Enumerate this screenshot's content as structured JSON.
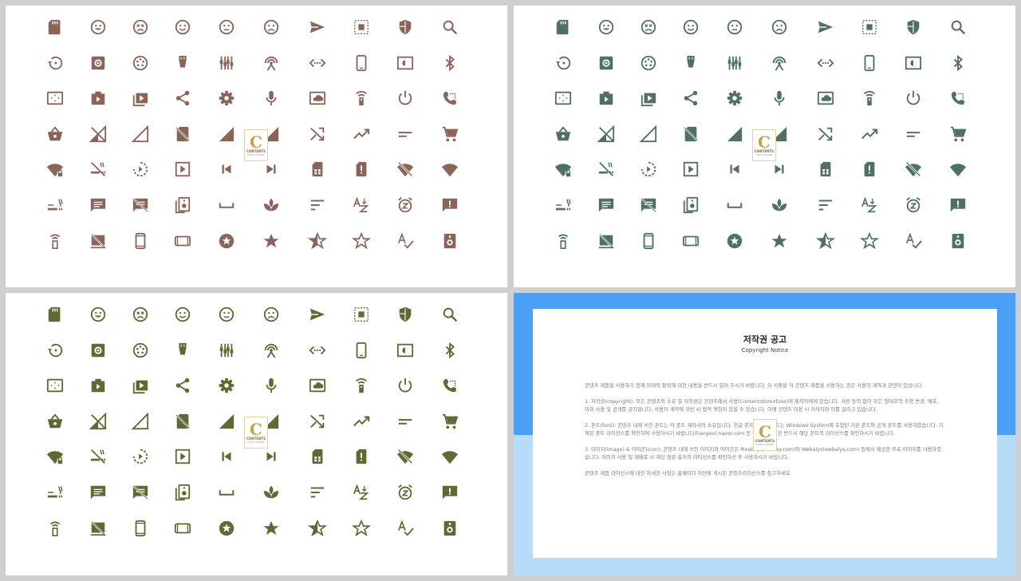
{
  "panels": [
    {
      "id": "p1",
      "color": "#8a6459"
    },
    {
      "id": "p2",
      "color": "#4f7062"
    },
    {
      "id": "p3",
      "color": "#5e6a33"
    }
  ],
  "icon_rows": [
    [
      "sd-card-icon",
      "smile-icon",
      "dead-face-icon",
      "satisfied-face-icon",
      "neutral-face-icon",
      "sad-face-icon",
      "send-icon",
      "select-all-icon",
      "security-shield-icon",
      "search-icon"
    ],
    [
      "restore-icon",
      "settings-applications-icon",
      "settings-input-component-icon",
      "settings-input-hdmi-icon",
      "settings-input-composite-icon",
      "settings-input-antenna-icon",
      "settings-ethernet-icon",
      "phone-android-icon",
      "brightness-icon",
      "bluetooth-icon"
    ],
    [
      "overscan-icon",
      "slideshow-icon",
      "video-library-icon",
      "share-icon",
      "settings-icon",
      "mic-icon",
      "cloud-box-icon",
      "remote-icon",
      "power-icon",
      "phone-dial-icon"
    ],
    [
      "shopping-basket-icon",
      "signal-off-icon",
      "signal-null-icon",
      "sim-off-icon",
      "signal-cellular-left-icon",
      "signal-cellular-right-icon",
      "shuffle-icon",
      "trending-icon",
      "short-text-icon",
      "shopping-cart-icon"
    ],
    [
      "wifi-lock-icon",
      "smoke-free-icon",
      "slow-motion-icon",
      "play-box-icon",
      "skip-previous-icon",
      "skip-next-icon",
      "sim-card-icon",
      "sim-alert-icon",
      "wifi-off-icon",
      "wifi-full-icon"
    ],
    [
      "smoking-icon",
      "sms-icon",
      "sms-failed-icon",
      "speaker-group-icon",
      "space-bar-icon",
      "spa-icon",
      "sort-icon",
      "sort-az-icon",
      "snooze-icon",
      "feedback-icon"
    ],
    [
      "remote-small-icon",
      "cast-off-icon",
      "smartphone-icon",
      "tablet-landscape-icon",
      "stars-icon",
      "star-icon",
      "star-half-icon",
      "star-border-icon",
      "spellcheck-icon",
      "speaker-icon"
    ]
  ],
  "logo": {
    "letter": "C",
    "line1": "CONTENTS",
    "line2": "FREE LICENSE"
  },
  "notice": {
    "title": "저작권 공고",
    "subtitle": "Copyright Notice",
    "intro": "콘텐츠 제품을 사용하기 전에 아래의 항목에 대한 내용을 반드시 읽어 주시기 바랍니다. 위 사항을 이 콘텐츠 제품을 사용하는 것은 사용자 계약과 관련이 있습니다.",
    "item1": "1. 저작권(copyright): 모든 콘텐츠의 소유 및 저작권은 콘텐츠에서 사용(Contentstoreofuse)에 제작자에게 있습니다. 사전 동의 없이 모든 형태로의 수정 변경, 배포, 이외 사용 및 공개를 금지합니다. 사용자 계약에 위반 시 법적 책임이 있을 수 있습니다. 이에 콘텐츠 이용 시 저작자와 이를 알리고 있습니다.",
    "item2": "2. 폰트(font): 콘텐츠 내에 쓰인 폰트는 각 폰트 제작사의 소유입니다. 한글 폰트와 영문 폰트는 Windows System에 포함된 기본 폰트와 공개 폰트를 사용하였습니다. 기재된 폰트 라이선스를 확인하여 사용하시기 바랍니다(hangeul.naver.com 등 참고). 사용 전 반드시 해당 폰트의 라이선스를 확인하시기 바랍니다.",
    "item3": "3. 이미지(image) & 아이콘(icon): 콘텐츠 내에 쓰인 이미지와 아이콘은 Pixabay(pixabay.com)와 Webalys(webalys.com) 등에서 제공한 무료 이미지를 사용하였습니다. 이미지 사용 및 재배포 시 해당 원본 출처의 라이선스를 확인하신 후 사용하시기 바랍니다.",
    "outro": "콘텐츠 제품 라이선스에 대한 자세한 사항은 홈페이지 하단에 게시된 콘텐츠라이선스를 참고하세요."
  }
}
